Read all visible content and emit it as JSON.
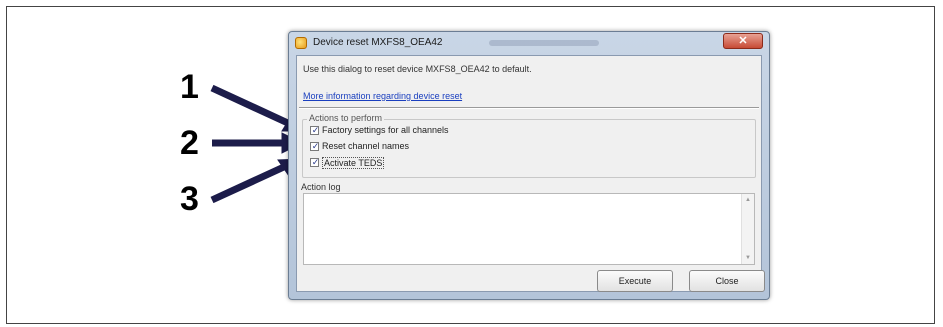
{
  "callouts": [
    "1",
    "2",
    "3"
  ],
  "dialog": {
    "title": "Device reset MXFS8_OEA42",
    "close_glyph": "✕",
    "intro_text": "Use this dialog to reset device MXFS8_OEA42 to default.",
    "info_link": "More information regarding device reset",
    "actions_group": {
      "legend": "Actions to perform",
      "items": [
        {
          "label": "Factory settings for all channels",
          "checked": true
        },
        {
          "label": "Reset channel names",
          "checked": true
        },
        {
          "label": "Activate TEDS",
          "checked": true
        }
      ]
    },
    "action_log_label": "Action log",
    "action_log_value": "",
    "buttons": {
      "execute": "Execute",
      "close": "Close"
    }
  },
  "icons": {
    "title_icon": "app-icon",
    "check": "✓",
    "scroll_up": "▲",
    "scroll_down": "▼"
  }
}
